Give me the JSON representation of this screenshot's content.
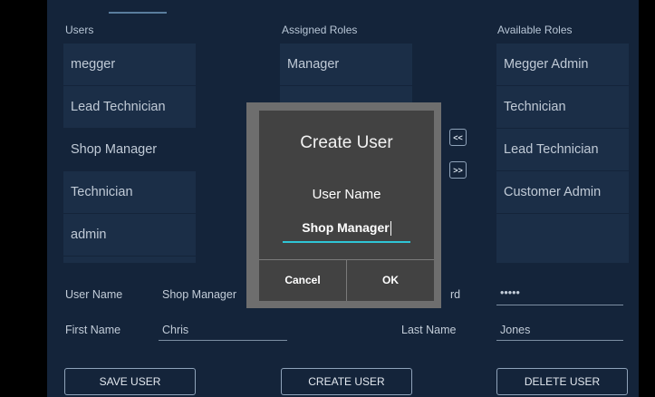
{
  "columns": {
    "users_label": "Users",
    "assigned_label": "Assigned Roles",
    "available_label": "Available Roles"
  },
  "users": [
    "megger",
    "Lead Technician",
    "Shop Manager",
    "Technician",
    "admin"
  ],
  "assigned_roles": [
    "Manager"
  ],
  "available_roles": [
    "Megger Admin",
    "Technician",
    "Lead Technician",
    "Customer Admin"
  ],
  "arrows": {
    "remove": "<<",
    "add": ">>"
  },
  "form": {
    "user_name_label": "User Name",
    "user_name_value": "Shop Manager",
    "password_label_fragment": "rd",
    "password_value": "•••••",
    "first_name_label": "First Name",
    "first_name_value": "Chris",
    "last_name_label": "Last Name",
    "last_name_value": "Jones"
  },
  "actions": {
    "save": "SAVE USER",
    "create": "CREATE USER",
    "delete": "DELETE USER"
  },
  "dialog": {
    "title": "Create User",
    "field_label": "User Name",
    "field_value": "Shop Manager",
    "cancel": "Cancel",
    "ok": "OK"
  },
  "colors": {
    "panel": "#14243a",
    "list_item": "#1b2e47",
    "dialog": "#424242",
    "accent": "#2fc5d6"
  }
}
